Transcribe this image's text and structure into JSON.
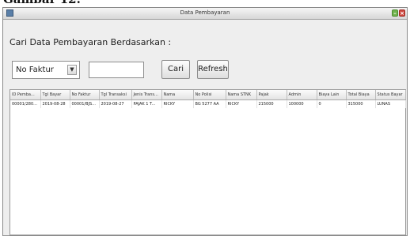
{
  "caption": "Gambar 12.",
  "window": {
    "title": "Data Pembayaran"
  },
  "search": {
    "label": "Cari Data Pembayaran Berdasarkan :",
    "selected": "No Faktur",
    "query": "",
    "search_button": "Cari",
    "refresh_button": "Refresh"
  },
  "table": {
    "columns": [
      "ID Pemba...",
      "Tgl Bayar",
      "No Faktur",
      "Tgl Transaksi",
      "Jenis Trans...",
      "Nama",
      "No Polisi",
      "Nama STNK",
      "Pajak",
      "Admin",
      "Biaya Lain",
      "Total Biaya",
      "Status Bayar"
    ],
    "rows": [
      [
        "00001/280...",
        "2019-08-28",
        "00001/BJS...",
        "2019-08-27",
        "PAJAK 1 T...",
        "RICKY",
        "BG 5277 AA",
        "RICKY",
        "215000",
        "100000",
        "0",
        "315000",
        "LUNAS"
      ]
    ]
  }
}
